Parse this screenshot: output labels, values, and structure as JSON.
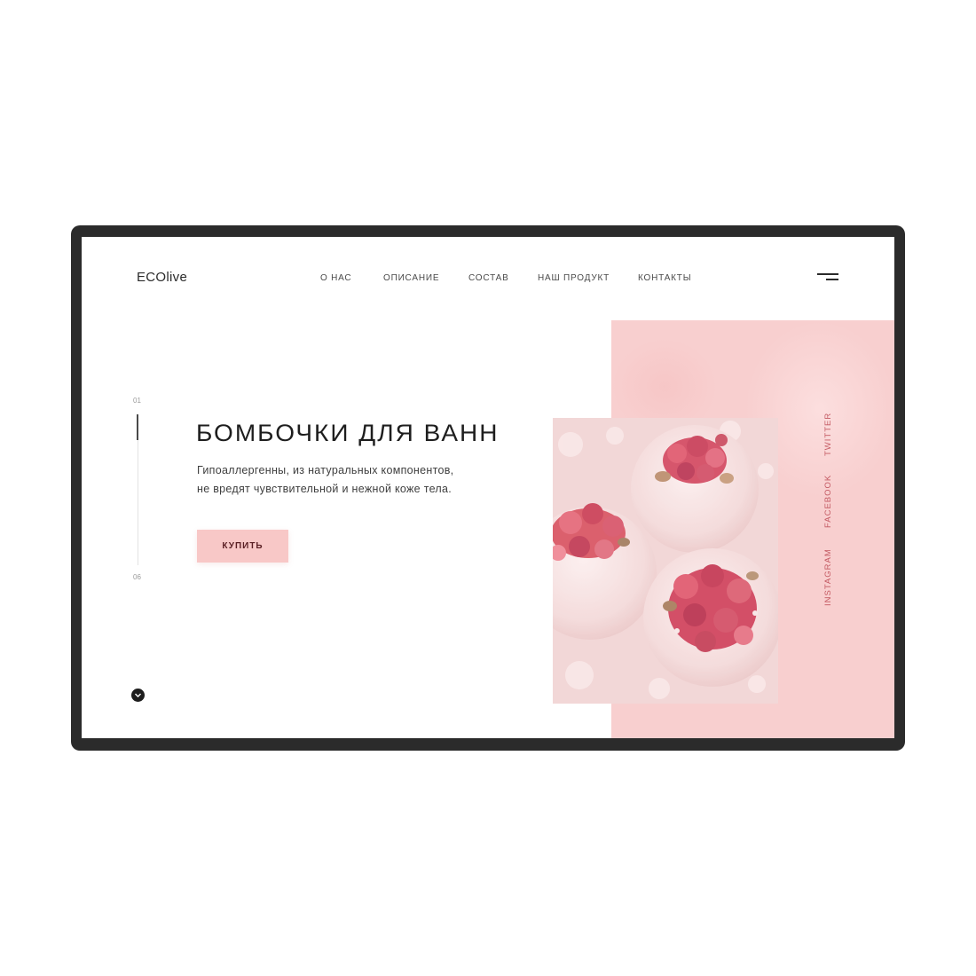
{
  "header": {
    "logo": "ECOlive",
    "nav": [
      {
        "label": "О НАС"
      },
      {
        "label": "ОПИСАНИЕ"
      },
      {
        "label": "СОСТАВ"
      },
      {
        "label": "НАШ ПРОДУКТ"
      },
      {
        "label": "КОНТАКТЫ"
      }
    ],
    "menu_icon": "hamburger-icon"
  },
  "pager": {
    "current": "01",
    "total": "06",
    "progress_fraction": 0.17
  },
  "hero": {
    "title": "БОМБОЧКИ ДЛЯ ВАНН",
    "description_line1": "Гипоаллергенны, из натуральных компонентов,",
    "description_line2": "не вредят чувствительной и нежной коже тела.",
    "buy_label": "КУПИТЬ"
  },
  "social": {
    "twitter": "TWITTER",
    "facebook": "FACEBOOK",
    "instagram": "INSTAGRAM"
  },
  "scroll_icon": "chevron-down-icon",
  "colors": {
    "frame": "#2b2b2b",
    "accent_pink": "#f8cfcf",
    "button_pink": "#f8c8c7",
    "social_text": "#c45a63",
    "text_dark": "#1e1e1e"
  }
}
